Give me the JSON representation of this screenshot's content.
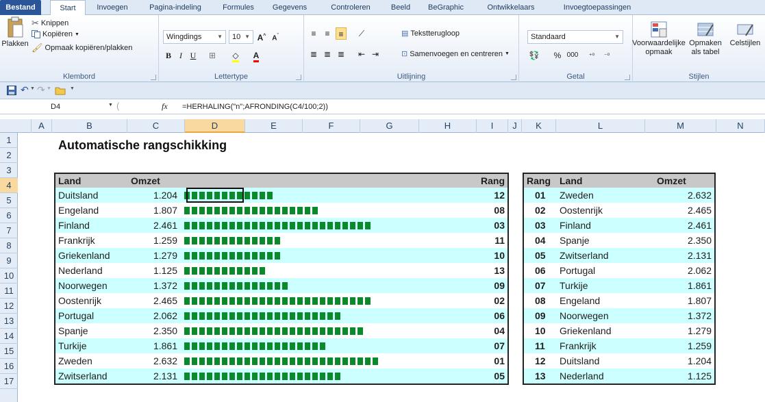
{
  "tabs": [
    "Bestand",
    "Start",
    "Invoegen",
    "Pagina-indeling",
    "Formules",
    "Gegevens",
    "Controleren",
    "Beeld",
    "BeGraphic",
    "Ontwikkelaars",
    "Invoegtoepassingen"
  ],
  "ribbon": {
    "clipboard": {
      "paste": "Plakken",
      "cut": "Knippen",
      "copy": "Kopiëren",
      "format_painter": "Opmaak kopiëren/plakken",
      "label": "Klembord"
    },
    "font": {
      "font_name": "Wingdings",
      "font_size": "10",
      "label": "Lettertype"
    },
    "alignment": {
      "wrap": "Tekstterugloop",
      "merge": "Samenvoegen en centreren",
      "label": "Uitlijning"
    },
    "number": {
      "format": "Standaard",
      "percent": "%",
      "thousands": "000",
      "label": "Getal"
    },
    "styles": {
      "conditional_1": "Voorwaardelijke",
      "conditional_2": "opmaak",
      "table_1": "Opmaken",
      "table_2": "als tabel",
      "cell": "Celstijlen",
      "label": "Stijlen"
    }
  },
  "formula_bar": {
    "name_box": "D4",
    "fx": "fx",
    "formula": "=HERHALING(\"n\";AFRONDING(C4/100;2))"
  },
  "columns": [
    "A",
    "B",
    "C",
    "D",
    "E",
    "F",
    "G",
    "H",
    "I",
    "J",
    "K",
    "L",
    "M",
    "N"
  ],
  "rows": [
    "1",
    "2",
    "3",
    "4",
    "5",
    "6",
    "7",
    "8",
    "9",
    "10",
    "11",
    "12",
    "13",
    "14",
    "15",
    "16",
    "17"
  ],
  "sheet": {
    "title": "Automatische rangschikking",
    "left_table": {
      "headers": {
        "country": "Land",
        "revenue": "Omzet",
        "rank": "Rang"
      },
      "rows": [
        {
          "country": "Duitsland",
          "revenue": "1.204",
          "value": 1204,
          "rank": "12"
        },
        {
          "country": "Engeland",
          "revenue": "1.807",
          "value": 1807,
          "rank": "08"
        },
        {
          "country": "Finland",
          "revenue": "2.461",
          "value": 2461,
          "rank": "03"
        },
        {
          "country": "Frankrijk",
          "revenue": "1.259",
          "value": 1259,
          "rank": "11"
        },
        {
          "country": "Griekenland",
          "revenue": "1.279",
          "value": 1279,
          "rank": "10"
        },
        {
          "country": "Nederland",
          "revenue": "1.125",
          "value": 1125,
          "rank": "13"
        },
        {
          "country": "Noorwegen",
          "revenue": "1.372",
          "value": 1372,
          "rank": "09"
        },
        {
          "country": "Oostenrijk",
          "revenue": "2.465",
          "value": 2465,
          "rank": "02"
        },
        {
          "country": "Portugal",
          "revenue": "2.062",
          "value": 2062,
          "rank": "06"
        },
        {
          "country": "Spanje",
          "revenue": "2.350",
          "value": 2350,
          "rank": "04"
        },
        {
          "country": "Turkije",
          "revenue": "1.861",
          "value": 1861,
          "rank": "07"
        },
        {
          "country": "Zweden",
          "revenue": "2.632",
          "value": 2632,
          "rank": "01"
        },
        {
          "country": "Zwitserland",
          "revenue": "2.131",
          "value": 2131,
          "rank": "05"
        }
      ]
    },
    "right_table": {
      "headers": {
        "rank": "Rang",
        "country": "Land",
        "revenue": "Omzet"
      },
      "rows": [
        {
          "rank": "01",
          "country": "Zweden",
          "revenue": "2.632"
        },
        {
          "rank": "02",
          "country": "Oostenrijk",
          "revenue": "2.465"
        },
        {
          "rank": "03",
          "country": "Finland",
          "revenue": "2.461"
        },
        {
          "rank": "04",
          "country": "Spanje",
          "revenue": "2.350"
        },
        {
          "rank": "05",
          "country": "Zwitserland",
          "revenue": "2.131"
        },
        {
          "rank": "06",
          "country": "Portugal",
          "revenue": "2.062"
        },
        {
          "rank": "07",
          "country": "Turkije",
          "revenue": "1.861"
        },
        {
          "rank": "08",
          "country": "Engeland",
          "revenue": "1.807"
        },
        {
          "rank": "09",
          "country": "Noorwegen",
          "revenue": "1.372"
        },
        {
          "rank": "10",
          "country": "Griekenland",
          "revenue": "1.279"
        },
        {
          "rank": "11",
          "country": "Frankrijk",
          "revenue": "1.259"
        },
        {
          "rank": "12",
          "country": "Duitsland",
          "revenue": "1.204"
        },
        {
          "rank": "13",
          "country": "Nederland",
          "revenue": "1.125"
        }
      ]
    }
  },
  "colors": {
    "accent": "#2a5699",
    "bar": "#0a8a2a",
    "row_stripe": "#ccffff",
    "header_fill": "#c8c8c8",
    "selection": "#f9d99f"
  }
}
